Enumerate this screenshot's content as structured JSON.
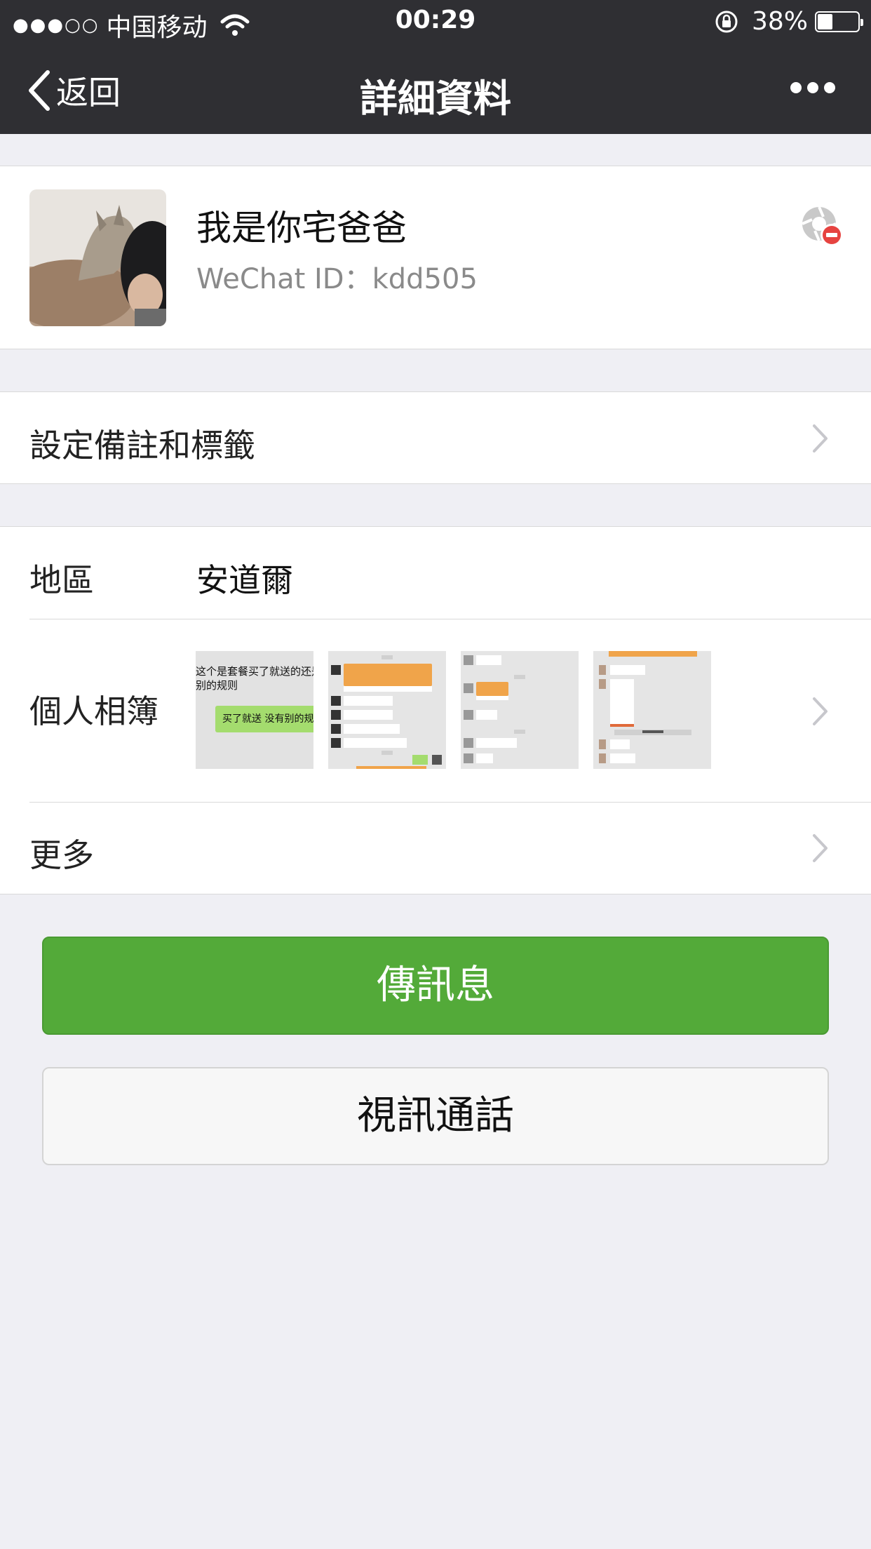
{
  "status_bar": {
    "signal": "●●●○○",
    "carrier": "中国移动",
    "time": "00:29",
    "battery": "38%",
    "battery_level": 0.38
  },
  "nav": {
    "back_label": "返回",
    "title": "詳細資料"
  },
  "profile": {
    "name": "我是你宅爸爸",
    "wechat_id": "WeChat ID：kdd505"
  },
  "rows": {
    "remark_label": "設定備註和標籤",
    "region_label": "地區",
    "region_value": "安道爾",
    "album_label": "個人相簿",
    "more_label": "更多"
  },
  "album": {
    "thumb1_line1": "这个是套餐买了就送的还是",
    "thumb1_line2": "别的规则",
    "thumb1_bubble": "买了就送 没有别的规"
  },
  "buttons": {
    "message": "傳訊息",
    "video_call": "視訊通話"
  },
  "colors": {
    "nav_bg": "#2f2f33",
    "page_bg": "#efeff4",
    "primary_green": "#53aa39",
    "chevron": "#c7c7cc"
  }
}
